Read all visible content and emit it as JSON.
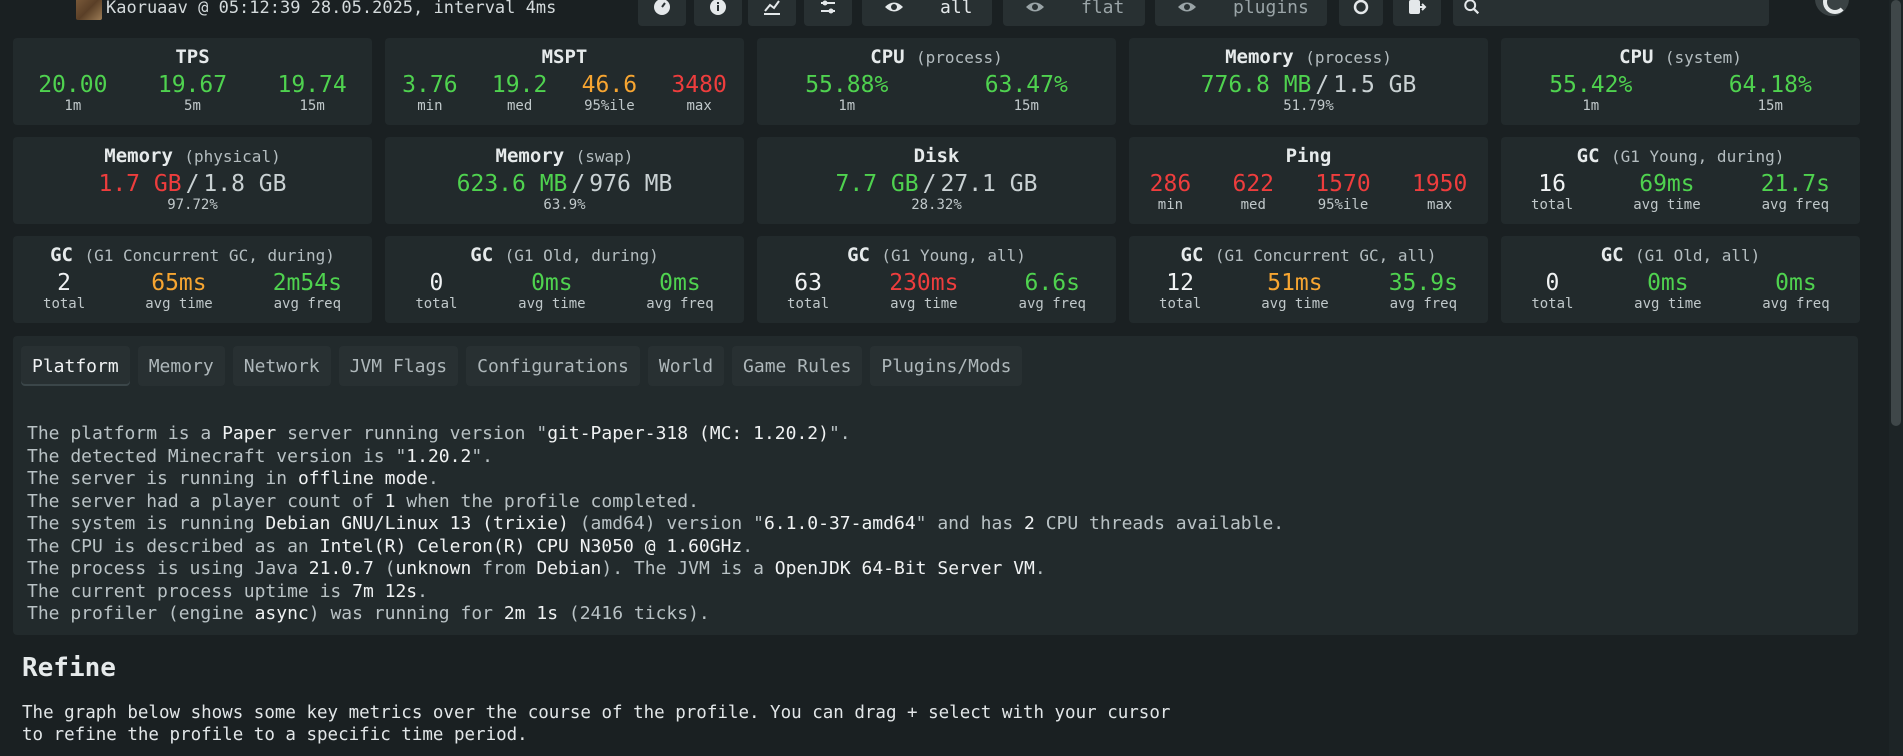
{
  "header": {
    "info": "Kaoruaav @ 05:12:39 28.05.2025, interval 4ms",
    "toggles": [
      {
        "label": "all",
        "icon": "eye-icon"
      },
      {
        "label": "flat",
        "icon": "eye-icon"
      },
      {
        "label": "plugins",
        "icon": "eye-icon"
      }
    ]
  },
  "row1": {
    "tps": {
      "title": "TPS",
      "values": [
        "20.00",
        "19.67",
        "19.74"
      ],
      "labels": [
        "1m",
        "5m",
        "15m"
      ]
    },
    "mspt": {
      "title": "MSPT",
      "values": [
        "3.76",
        "19.2",
        "46.6",
        "3480"
      ],
      "labels": [
        "min",
        "med",
        "95%ile",
        "max"
      ]
    },
    "cpu_process": {
      "title": "CPU",
      "sub": "(process)",
      "values": [
        "55.88%",
        "63.47%"
      ],
      "labels": [
        "1m",
        "15m"
      ]
    },
    "mem_process": {
      "title": "Memory",
      "sub": "(process)",
      "used": "776.8 MB",
      "total": "1.5 GB",
      "pct": "51.79%"
    },
    "cpu_system": {
      "title": "CPU",
      "sub": "(system)",
      "values": [
        "55.42%",
        "64.18%"
      ],
      "labels": [
        "1m",
        "15m"
      ]
    }
  },
  "row2": {
    "mem_physical": {
      "title": "Memory",
      "sub": "(physical)",
      "used": "1.7 GB",
      "total": "1.8 GB",
      "pct": "97.72%"
    },
    "mem_swap": {
      "title": "Memory",
      "sub": "(swap)",
      "used": "623.6 MB",
      "total": "976 MB",
      "pct": "63.9%"
    },
    "disk": {
      "title": "Disk",
      "used": "7.7 GB",
      "total": "27.1 GB",
      "pct": "28.32%"
    },
    "ping": {
      "title": "Ping",
      "values": [
        "286",
        "622",
        "1570",
        "1950"
      ],
      "labels": [
        "min",
        "med",
        "95%ile",
        "max"
      ]
    },
    "gc_young_during": {
      "title": "GC",
      "sub": "(G1 Young, during)",
      "values": [
        "16",
        "69ms",
        "21.7s"
      ],
      "labels": [
        "total",
        "avg time",
        "avg freq"
      ]
    }
  },
  "row3": {
    "gc_concurrent_during": {
      "title": "GC",
      "sub": "(G1 Concurrent GC, during)",
      "values": [
        "2",
        "65ms",
        "2m54s"
      ],
      "labels": [
        "total",
        "avg time",
        "avg freq"
      ]
    },
    "gc_old_during": {
      "title": "GC",
      "sub": "(G1 Old, during)",
      "values": [
        "0",
        "0ms",
        "0ms"
      ],
      "labels": [
        "total",
        "avg time",
        "avg freq"
      ]
    },
    "gc_young_all": {
      "title": "GC",
      "sub": "(G1 Young, all)",
      "values": [
        "63",
        "230ms",
        "6.6s"
      ],
      "labels": [
        "total",
        "avg time",
        "avg freq"
      ]
    },
    "gc_concurrent_all": {
      "title": "GC",
      "sub": "(G1 Concurrent GC, all)",
      "values": [
        "12",
        "51ms",
        "35.9s"
      ],
      "labels": [
        "total",
        "avg time",
        "avg freq"
      ]
    },
    "gc_old_all": {
      "title": "GC",
      "sub": "(G1 Old, all)",
      "values": [
        "0",
        "0ms",
        "0ms"
      ],
      "labels": [
        "total",
        "avg time",
        "avg freq"
      ]
    }
  },
  "tabs": [
    "Platform",
    "Memory",
    "Network",
    "JVM Flags",
    "Configurations",
    "World",
    "Game Rules",
    "Plugins/Mods"
  ],
  "platform": {
    "l1": [
      "The platform is a ",
      "Paper",
      " server running version \"",
      "git-Paper-318 (MC: 1.20.2)",
      "\"."
    ],
    "l2": [
      "The detected Minecraft version is \"",
      "1.20.2",
      "\"."
    ],
    "l3": [
      "The server is running in ",
      "offline mode",
      "."
    ],
    "l4": [
      "The server had a player count of ",
      "1",
      " when the profile completed."
    ],
    "l5": [
      "The system is running ",
      "Debian GNU/Linux 13 (trixie)",
      " (amd64) version \"",
      "6.1.0-37-amd64",
      "\" and has ",
      "2",
      " CPU threads available."
    ],
    "l6": [
      "The CPU is described as an ",
      "Intel(R) Celeron(R) CPU N3050 @ 1.60GHz",
      "."
    ],
    "l7": [
      "The process is using Java ",
      "21.0.7",
      " (",
      "unknown",
      " from ",
      "Debian",
      "). The JVM is a ",
      "OpenJDK 64-Bit Server VM",
      "."
    ],
    "l8": [
      "The current process uptime is ",
      "7m 12s",
      "."
    ],
    "l9": [
      "The profiler (engine ",
      "async",
      ") was running for ",
      "2m 1s",
      " (2416 ticks)."
    ]
  },
  "refine": {
    "title": "Refine",
    "text": "The graph below shows some key metrics over the course of the profile. You can drag + select with your cursor to refine the profile to a specific time period."
  }
}
